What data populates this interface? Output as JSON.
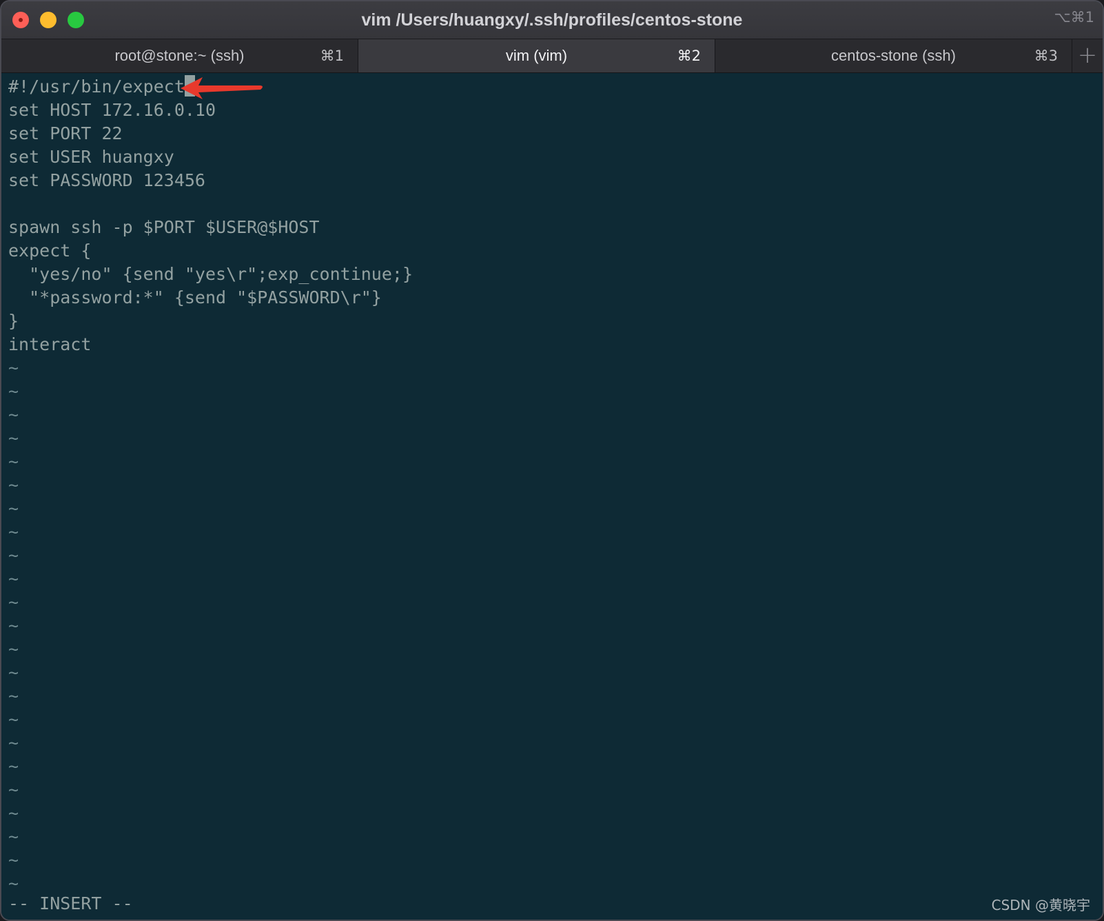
{
  "window": {
    "title": "vim /Users/huangxy/.ssh/profiles/centos-stone",
    "title_shortcut": "⌥⌘1"
  },
  "tabs": [
    {
      "label": "root@stone:~ (ssh)",
      "shortcut": "⌘1",
      "active": false
    },
    {
      "label": "vim (vim)",
      "shortcut": "⌘2",
      "active": true
    },
    {
      "label": "centos-stone (ssh)",
      "shortcut": "⌘3",
      "active": false
    }
  ],
  "new_tab_label": "+",
  "editor": {
    "lines": [
      "#!/usr/bin/expect",
      "set HOST 172.16.0.10",
      "set PORT 22",
      "set USER huangxy",
      "set PASSWORD 123456",
      "",
      "spawn ssh -p $PORT $USER@$HOST",
      "expect {",
      "  \"yes/no\" {send \"yes\\r\";exp_continue;}",
      "  \"*password:*\" {send \"$PASSWORD\\r\"}",
      "}",
      "interact"
    ],
    "empty_line_marker": "~",
    "empty_line_count": 23,
    "mode": "-- INSERT --"
  },
  "watermark": "CSDN @黄晓宇",
  "colors": {
    "background": "#0e2a35",
    "text": "#93a1a1",
    "arrow": "#e8392c"
  }
}
